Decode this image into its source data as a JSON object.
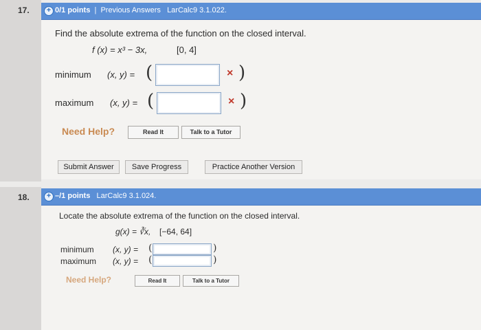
{
  "q17": {
    "number": "17.",
    "points": "0/1 points",
    "separator": "|",
    "previous_answers": "Previous Answers",
    "source": "LarCalc9 3.1.022.",
    "prompt": "Find the absolute extrema of the function on the closed interval.",
    "function": "f (x) = x³ − 3x,",
    "interval": "[0, 4]",
    "minimum_label": "minimum",
    "maximum_label": "maximum",
    "xy_label": "(x, y) =",
    "open_paren": "(",
    "close_paren": ")",
    "wrong_mark": "×",
    "minimum_value": "",
    "maximum_value": "",
    "need_help": "Need Help?",
    "read_it": "Read It",
    "talk_to_tutor": "Talk to a Tutor",
    "submit_answer": "Submit Answer",
    "save_progress": "Save Progress",
    "practice_another": "Practice Another Version"
  },
  "q18": {
    "number": "18.",
    "points": "–/1 points",
    "source": "LarCalc9 3.1.024.",
    "prompt": "Locate the absolute extrema of the function on the closed interval.",
    "function": "g(x) = ∛x,",
    "interval": "[−64, 64]",
    "minimum_label": "minimum",
    "maximum_label": "maximum",
    "xy_label": "(x, y) =",
    "open_paren": "(",
    "close_paren": ")",
    "minimum_value": "",
    "maximum_value": "",
    "need_help": "Need Help?",
    "read_it": "Read It",
    "talk_to_tutor": "Talk to a Tutor"
  },
  "colors": {
    "header_blue": "#5b8fd6",
    "wrong_red": "#c0392b",
    "help_orange": "#c98a52"
  }
}
